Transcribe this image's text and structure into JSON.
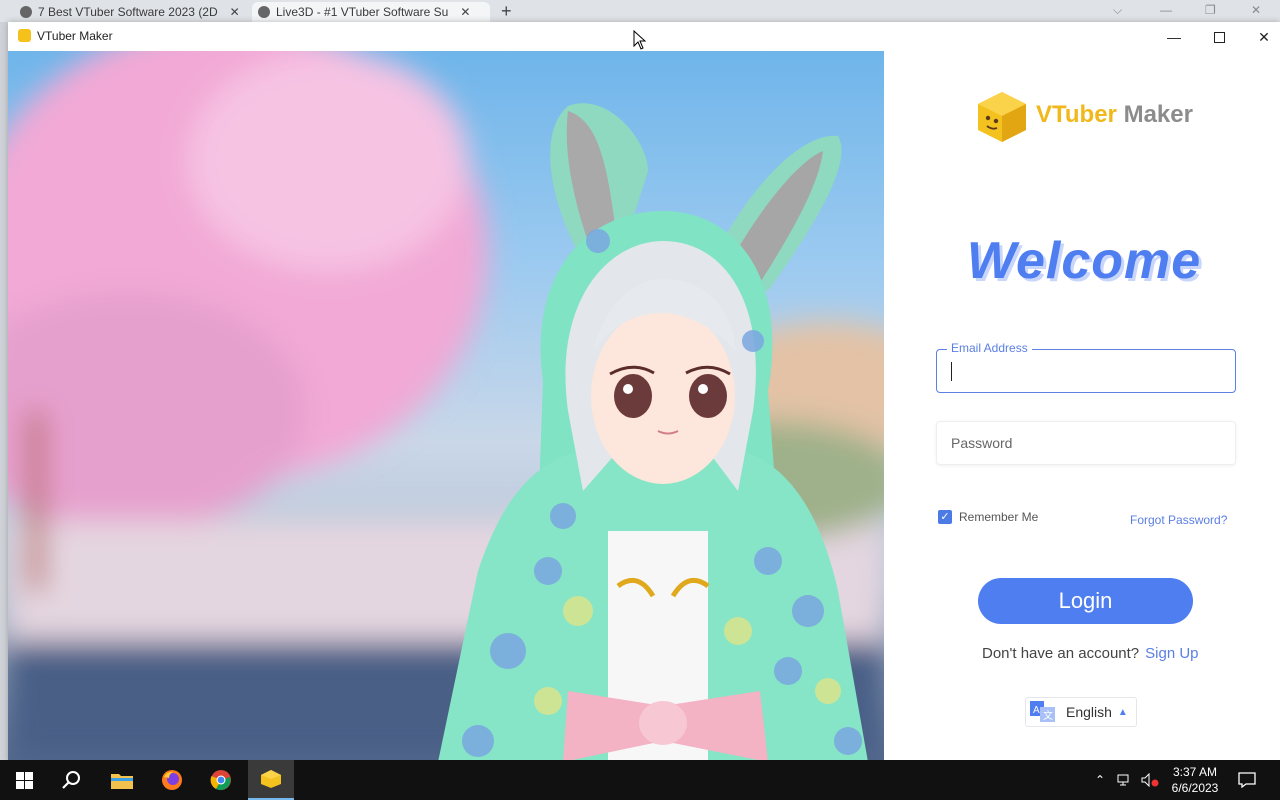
{
  "browser": {
    "tabs": [
      {
        "label": "7 Best VTuber Software 2023 (2D"
      },
      {
        "label": "Live3D - #1 VTuber Software Su"
      }
    ],
    "new_tab": "+"
  },
  "window": {
    "title": "VTuber Maker",
    "minimize": "—",
    "close": "✕"
  },
  "panel": {
    "logo": {
      "word1": "VTuber",
      "word2": "Maker"
    },
    "welcome": "Welcome",
    "email": {
      "label": "Email Address",
      "value": ""
    },
    "password": {
      "placeholder": "Password",
      "value": ""
    },
    "remember_me": {
      "label": "Remember Me",
      "checked": true
    },
    "forgot_password": "Forgot Password?",
    "login_button": "Login",
    "signup_prompt": "Don't have an account?",
    "signup_link": "Sign Up",
    "language": "English"
  },
  "taskbar": {
    "time": "3:37 AM",
    "date": "6/6/2023",
    "apps": [
      "start-icon",
      "search-icon",
      "file-explorer-icon",
      "firefox-icon",
      "chrome-icon",
      "vtuber-maker-icon"
    ]
  },
  "colors": {
    "accent": "#4f7ef0",
    "logo_yellow": "#f0b81a"
  }
}
